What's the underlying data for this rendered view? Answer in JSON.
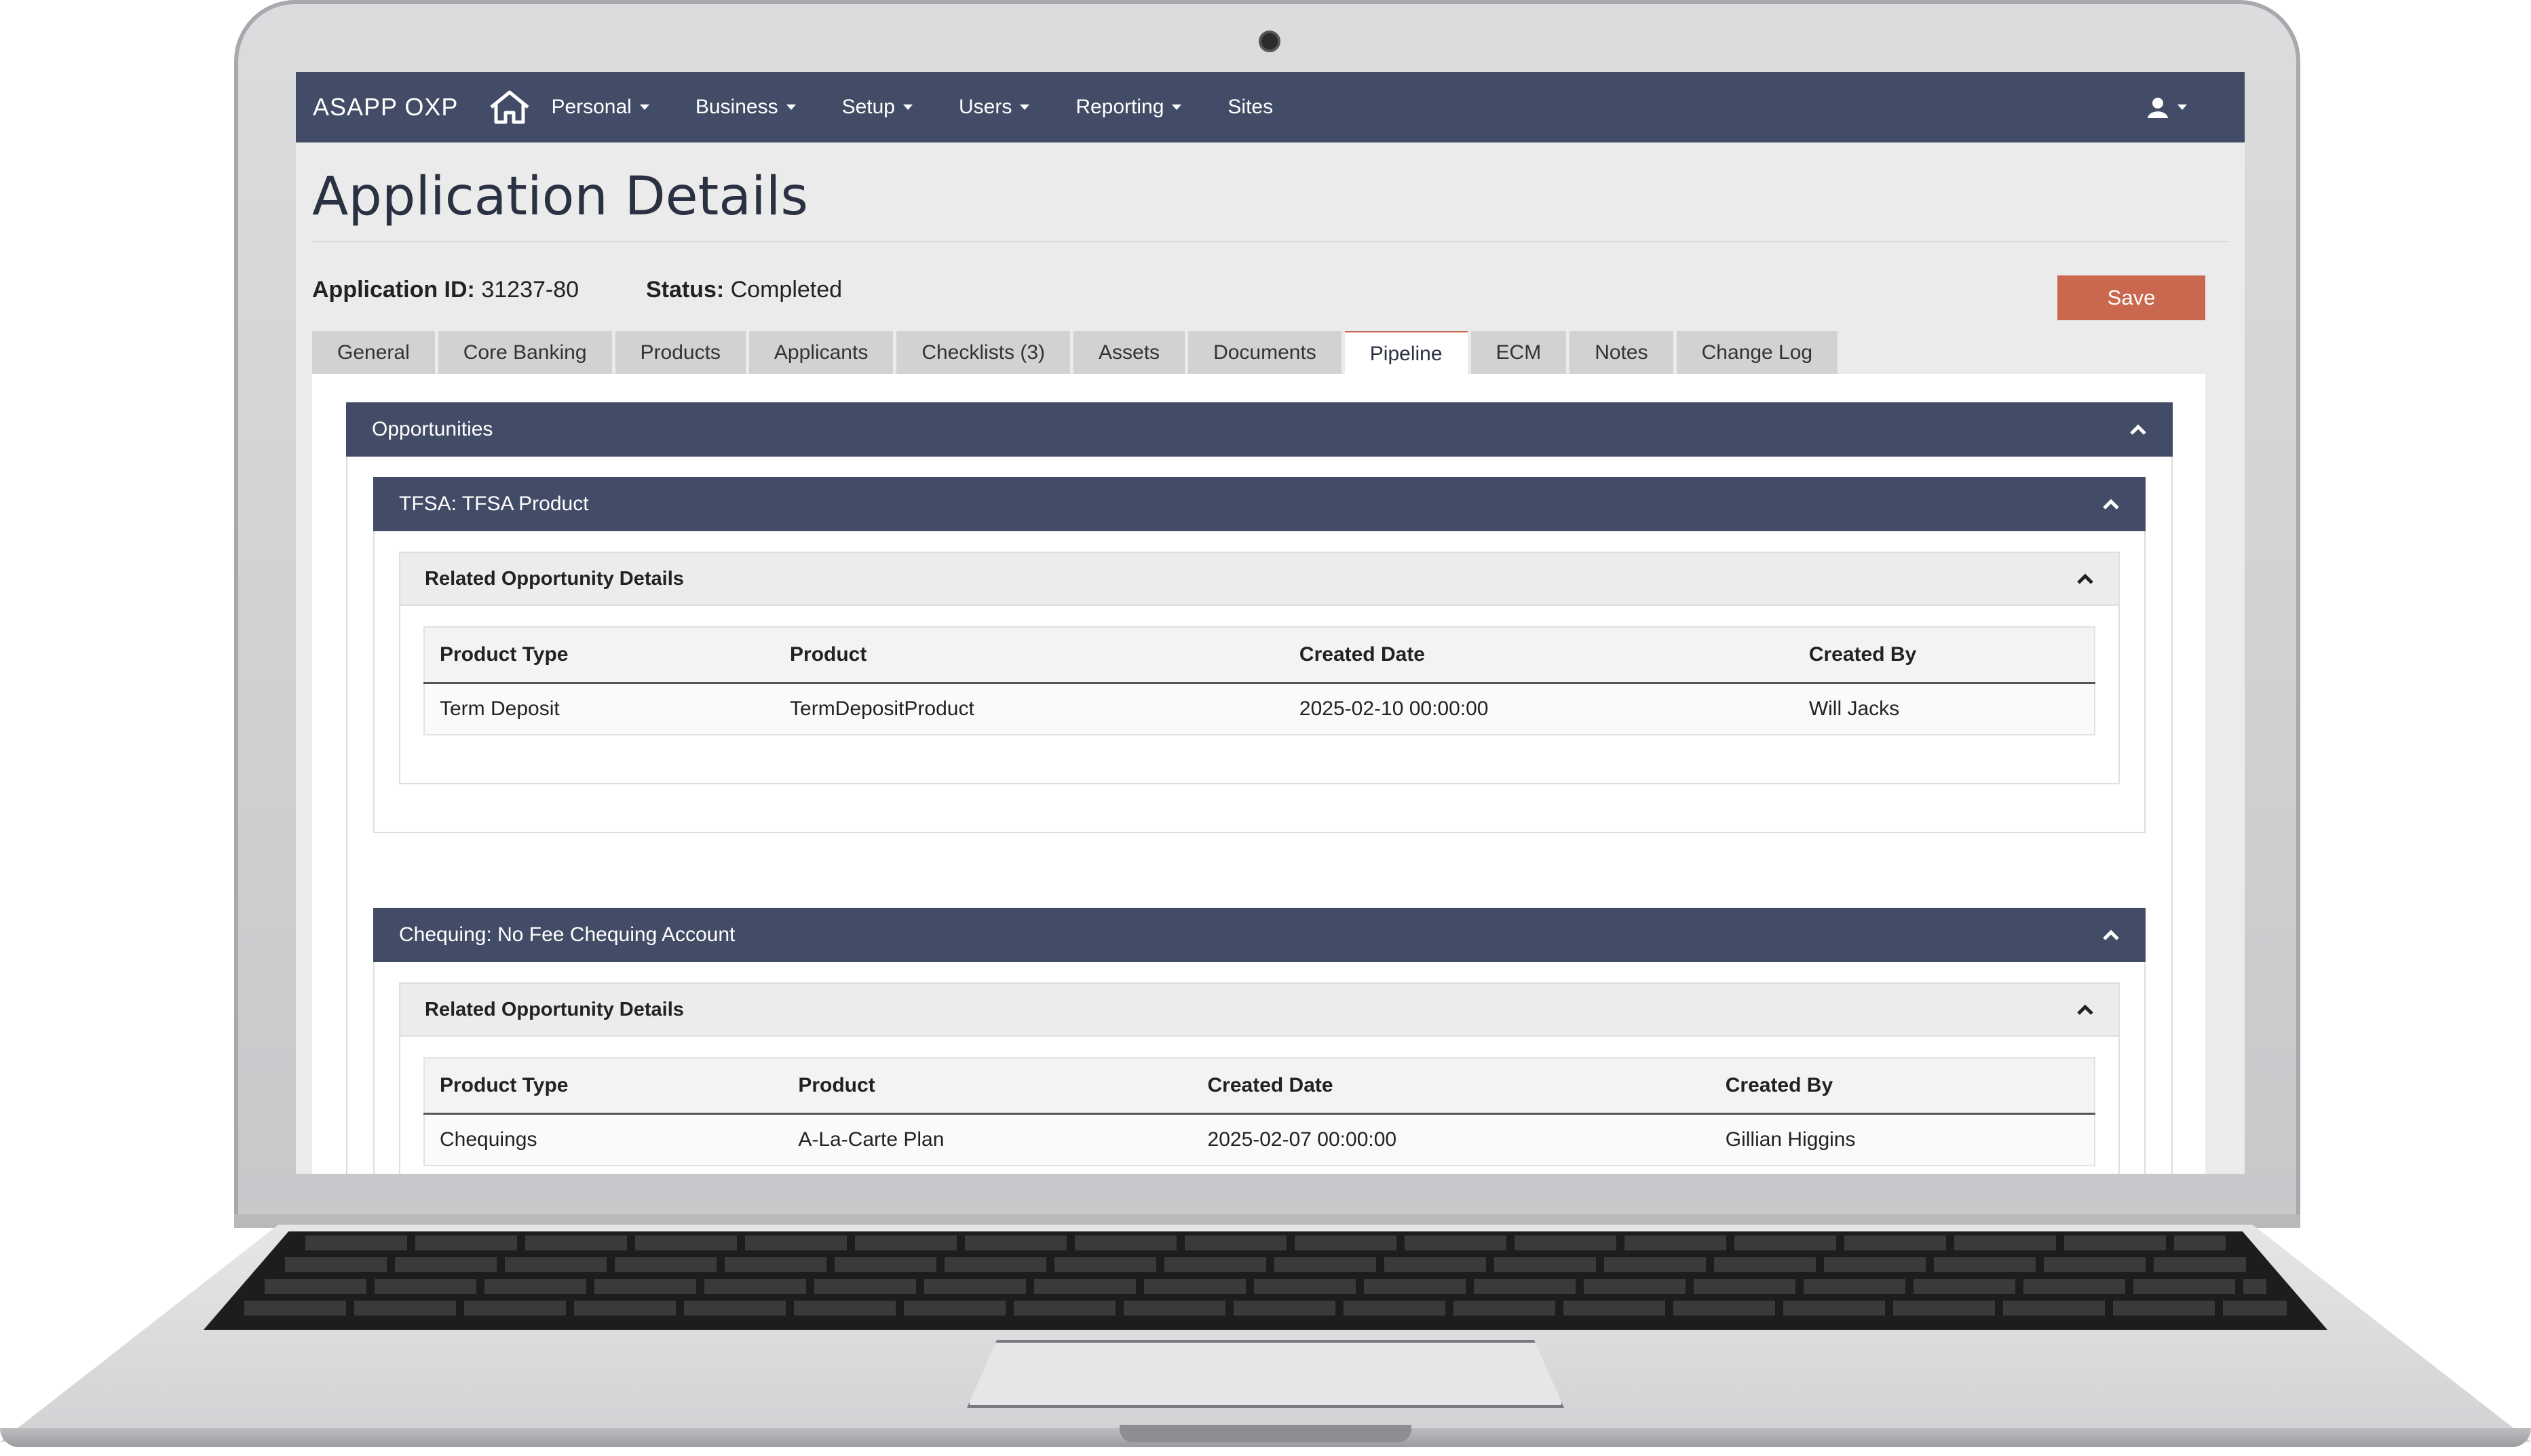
{
  "nav": {
    "brand": "ASAPP OXP",
    "items": [
      {
        "label": "Personal",
        "dropdown": true
      },
      {
        "label": "Business",
        "dropdown": true
      },
      {
        "label": "Setup",
        "dropdown": true
      },
      {
        "label": "Users",
        "dropdown": true
      },
      {
        "label": "Reporting",
        "dropdown": true
      },
      {
        "label": "Sites",
        "dropdown": false
      }
    ],
    "home_icon": "home-icon",
    "user_icon": "user-icon"
  },
  "page": {
    "title": "Application Details",
    "app_id_label": "Application ID:",
    "app_id": "31237-80",
    "status_label": "Status:",
    "status": "Completed",
    "save_label": "Save"
  },
  "tabs": [
    {
      "label": "General"
    },
    {
      "label": "Core Banking"
    },
    {
      "label": "Products"
    },
    {
      "label": "Applicants"
    },
    {
      "label": "Checklists (3)"
    },
    {
      "label": "Assets"
    },
    {
      "label": "Documents"
    },
    {
      "label": "Pipeline",
      "active": true
    },
    {
      "label": "ECM"
    },
    {
      "label": "Notes"
    },
    {
      "label": "Change Log"
    }
  ],
  "opportunities": {
    "title": "Opportunities",
    "groups": [
      {
        "title": "TFSA: TFSA Product",
        "details_title": "Related Opportunity Details",
        "columns": [
          "Product Type",
          "Product",
          "Created Date",
          "Created By"
        ],
        "row": [
          "Term Deposit",
          "TermDepositProduct",
          "2025-02-10 00:00:00",
          "Will Jacks"
        ]
      },
      {
        "title": "Chequing: No Fee Chequing Account",
        "details_title": "Related Opportunity Details",
        "columns": [
          "Product Type",
          "Product",
          "Created Date",
          "Created By"
        ],
        "row": [
          "Chequings",
          "A-La-Carte Plan",
          "2025-02-07 00:00:00",
          "Gillian Higgins"
        ]
      }
    ]
  },
  "colors": {
    "navbar": "#434c66",
    "accent": "#c9684e",
    "tab_inactive": "#d2d2d2"
  }
}
